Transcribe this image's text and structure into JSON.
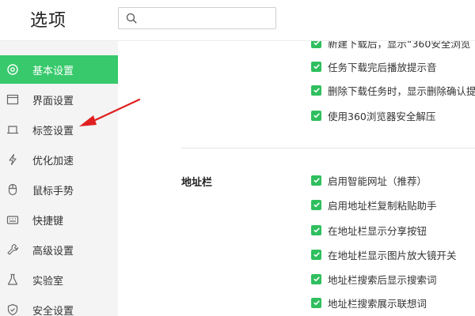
{
  "header": {
    "title": "选项",
    "search_placeholder": ""
  },
  "sidebar": {
    "items": [
      {
        "label": "基本设置",
        "icon": "gear-icon",
        "active": true
      },
      {
        "label": "界面设置",
        "icon": "window-icon",
        "active": false
      },
      {
        "label": "标签设置",
        "icon": "tab-icon",
        "active": false
      },
      {
        "label": "优化加速",
        "icon": "lightning-icon",
        "active": false
      },
      {
        "label": "鼠标手势",
        "icon": "mouse-icon",
        "active": false
      },
      {
        "label": "快捷键",
        "icon": "keyboard-icon",
        "active": false
      },
      {
        "label": "高级设置",
        "icon": "wrench-icon",
        "active": false
      },
      {
        "label": "实验室",
        "icon": "flask-icon",
        "active": false
      },
      {
        "label": "安全设置",
        "icon": "shield-icon",
        "active": false
      }
    ]
  },
  "download_options": [
    {
      "label": "新建下载后，显示“360安全浏览",
      "checked": true
    },
    {
      "label": "任务下载完后播放提示音",
      "checked": true
    },
    {
      "label": "删除下载任务时，显示删除确认提",
      "checked": true
    },
    {
      "label": "使用360浏览器安全解压",
      "checked": true
    }
  ],
  "address_bar": {
    "section_label": "地址栏",
    "options": [
      {
        "label": "启用智能网址（推荐）",
        "checked": true
      },
      {
        "label": "启用地址栏复制粘贴助手",
        "checked": true
      },
      {
        "label": "在地址栏显示分享按钮",
        "checked": true
      },
      {
        "label": "在地址栏显示图片放大镜开关",
        "checked": true
      },
      {
        "label": "地址栏搜索后显示搜索词",
        "checked": true
      },
      {
        "label": "地址栏搜索展示联想词",
        "checked": true
      }
    ]
  },
  "colors": {
    "accent": "#37c96b",
    "checkbox": "#2fbf5e",
    "annotation_arrow": "#e02020"
  }
}
